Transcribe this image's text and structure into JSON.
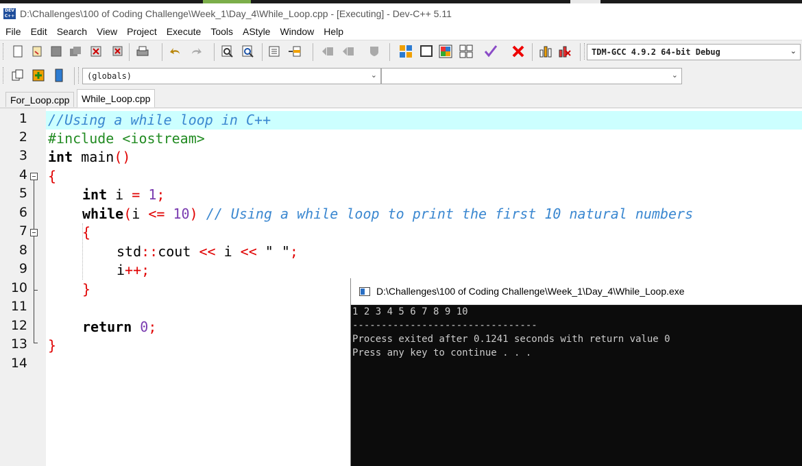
{
  "window": {
    "title": "D:\\Challenges\\100 of Coding Challenge\\Week_1\\Day_4\\While_Loop.cpp - [Executing] - Dev-C++ 5.11",
    "icon": "devcpp-app-icon"
  },
  "menu": [
    "File",
    "Edit",
    "Search",
    "View",
    "Project",
    "Execute",
    "Tools",
    "AStyle",
    "Window",
    "Help"
  ],
  "toolbar": {
    "compiler_select": "TDM-GCC 4.9.2 64-bit Debug",
    "scope_select": "(globals)",
    "function_select": ""
  },
  "tabs": [
    {
      "label": "For_Loop.cpp",
      "active": false
    },
    {
      "label": "While_Loop.cpp",
      "active": true
    }
  ],
  "editor": {
    "line_numbers": [
      "1",
      "2",
      "3",
      "4",
      "5",
      "6",
      "7",
      "8",
      "9",
      "10",
      "11",
      "12",
      "13",
      "14"
    ],
    "highlighted_line": 1,
    "lines": {
      "l1": "//Using a while loop in C++",
      "l2": "#include <iostream>",
      "l3_kw": "int",
      "l3_rest": " main",
      "l3_sym": "()",
      "l4": "{",
      "l5_kw": "int",
      "l5_a": " i ",
      "l5_eq": "=",
      "l5_num": "1",
      "l5_semi": ";",
      "l6_kw": "while",
      "l6_p1": "(",
      "l6_a": "i ",
      "l6_op": "<=",
      "l6_num": "10",
      "l6_p2": ")",
      "l6_cm": "// Using a while loop to print the first 10 natural numbers",
      "l7": "{",
      "l8_a": "std",
      "l8_op1": "::",
      "l8_b": "cout ",
      "l8_op2": "<<",
      "l8_c": " i ",
      "l8_op3": "<<",
      "l8_str": "\" \"",
      "l8_semi": ";",
      "l9_a": "i",
      "l9_op": "++;",
      "l10": "}",
      "l12_kw": "return",
      "l12_num": "0",
      "l12_semi": ";",
      "l13": "}"
    }
  },
  "console": {
    "title": "D:\\Challenges\\100 of Coding Challenge\\Week_1\\Day_4\\While_Loop.exe",
    "output_line": "1 2 3 4 5 6 7 8 9 10",
    "separator": "--------------------------------",
    "exit_message": "Process exited after 0.1241 seconds with return value 0",
    "continue_prompt": "Press any key to continue . . ."
  },
  "colors": {
    "comment": "#3a87d0",
    "preprocessor": "#228b22",
    "symbol": "#e00000",
    "number": "#7a3bb0",
    "current_line": "#ccffff"
  }
}
